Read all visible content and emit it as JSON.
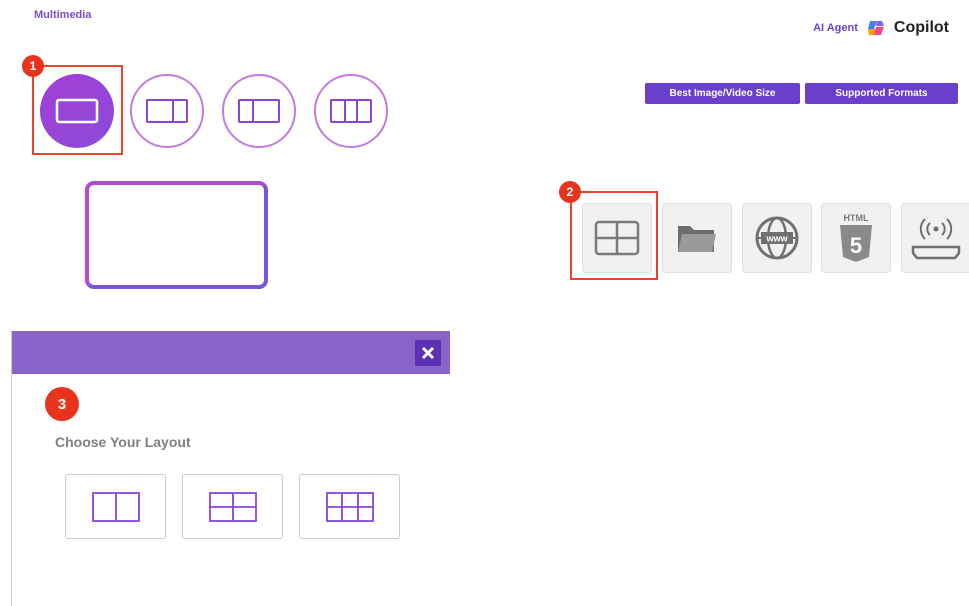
{
  "header": {
    "section_title": "Multimedia",
    "brand_agent": "AI Agent",
    "brand_name": "Copilot"
  },
  "buttons": {
    "best_size": "Best Image/Video Size",
    "supported_formats": "Supported Formats"
  },
  "layout_options": [
    {
      "icon": "single-screen-icon",
      "active": true
    },
    {
      "icon": "split-two-unequal-icon",
      "active": false
    },
    {
      "icon": "split-two-equal-icon",
      "active": false
    },
    {
      "icon": "split-three-icon",
      "active": false
    }
  ],
  "badges": {
    "one": "1",
    "two": "2",
    "three": "3"
  },
  "sources": [
    {
      "icon": "grid-layout-icon"
    },
    {
      "icon": "folder-icon"
    },
    {
      "icon": "globe-www-icon"
    },
    {
      "icon": "html5-icon",
      "label": "HTML",
      "digit": "5"
    },
    {
      "icon": "hdmi-broadcast-icon"
    }
  ],
  "modal": {
    "title": "Choose Your Layout",
    "close_glyph": "✕",
    "layouts": [
      {
        "icon": "layout-two-columns-icon"
      },
      {
        "icon": "layout-two-by-two-icon"
      },
      {
        "icon": "layout-three-by-two-icon"
      }
    ]
  },
  "colors": {
    "accent": "#6a3fcb",
    "modal_header": "#8a63c8",
    "highlight": "#e8442b",
    "badge": "#e8331d"
  }
}
